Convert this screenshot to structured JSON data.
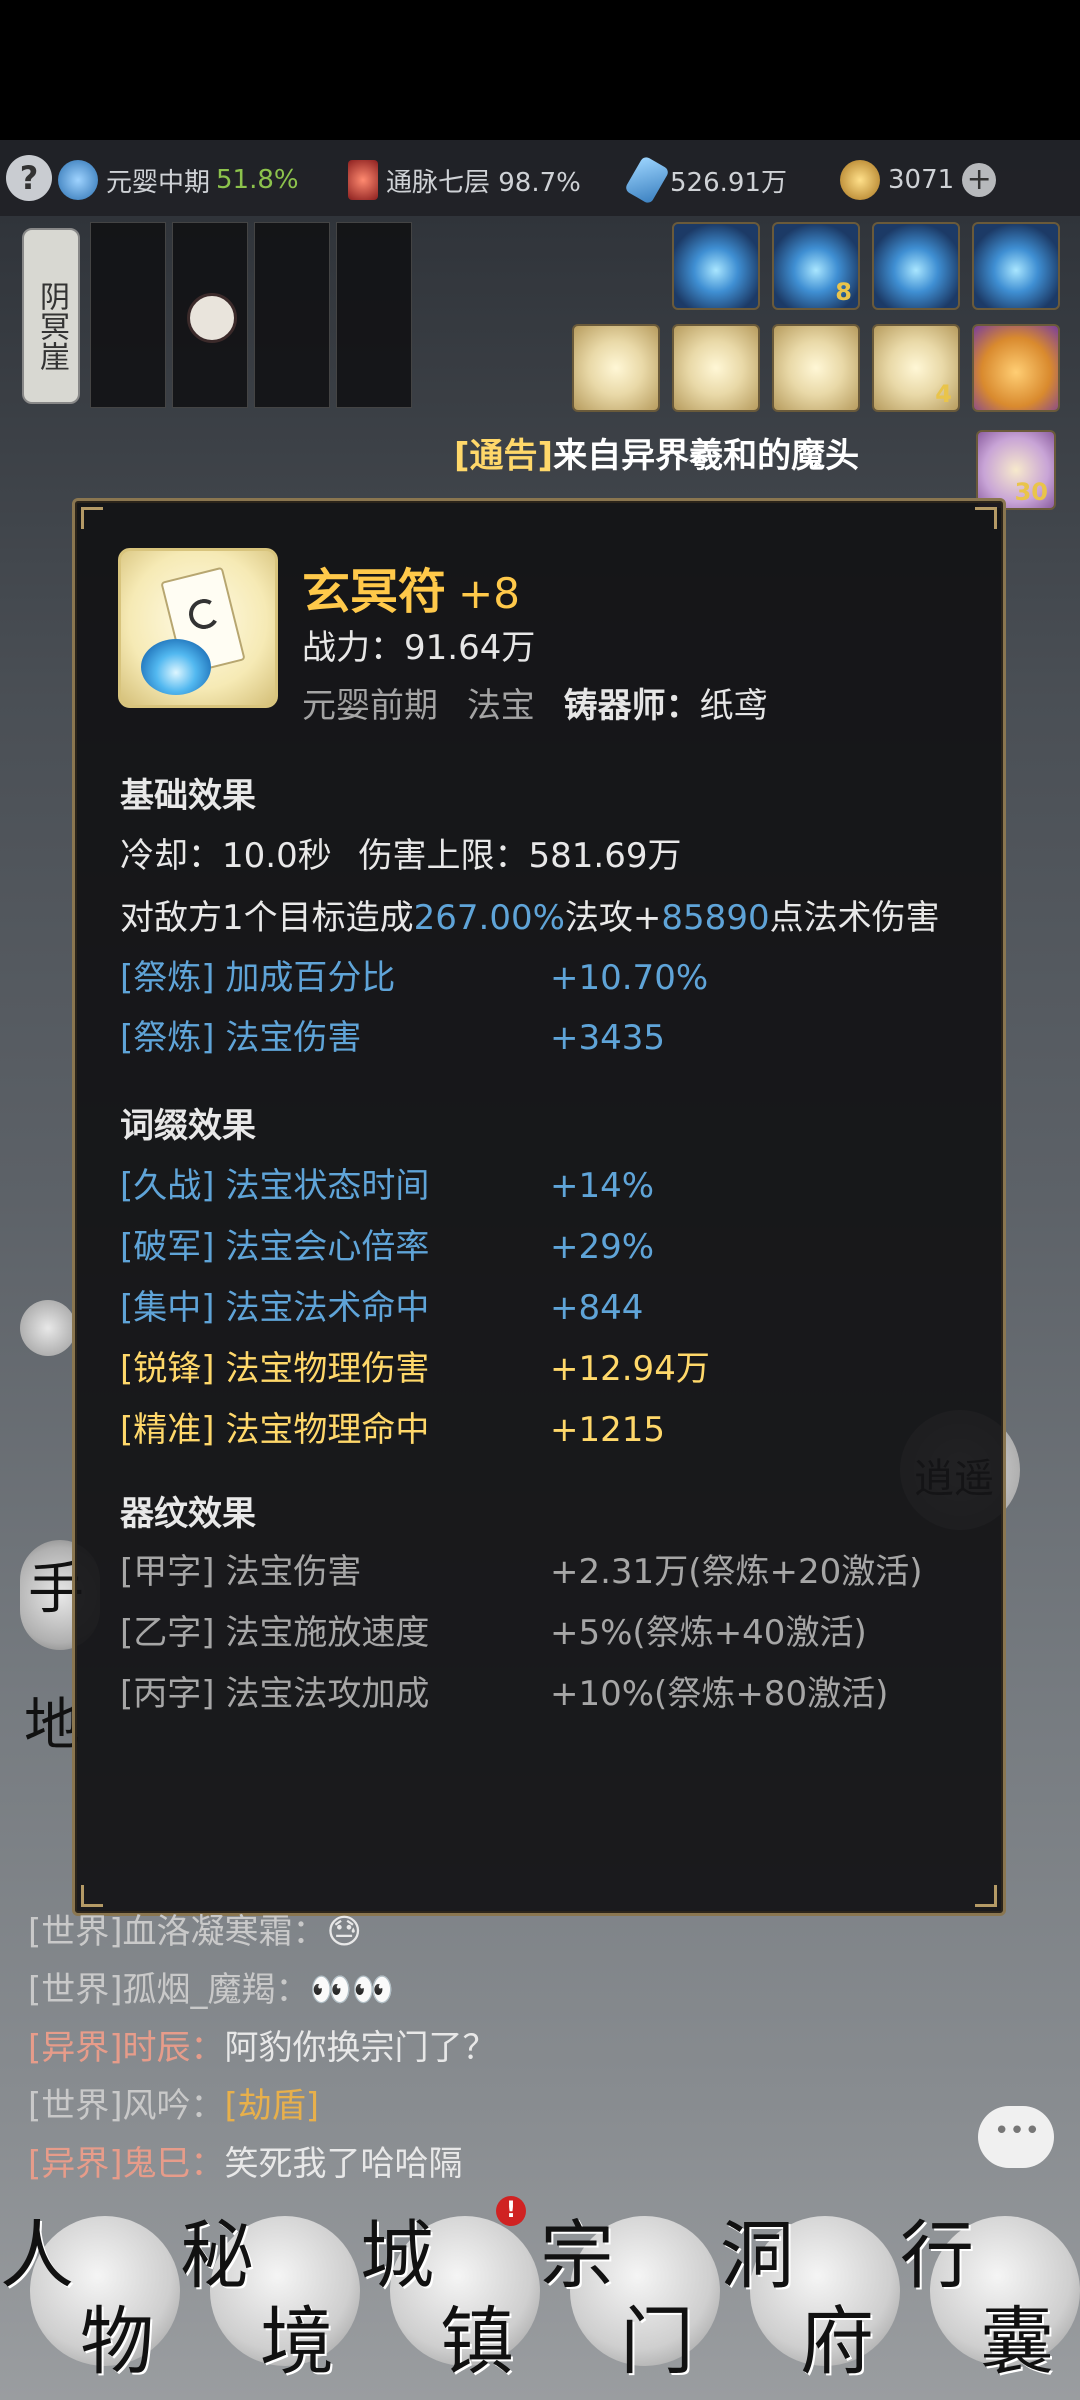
{
  "status": {
    "help_icon": "question-icon",
    "realm": "元婴中期",
    "realm_pct": "51.8%",
    "meridian": "通脉七层 98.7%",
    "spirit_stones": "526.91万",
    "coins": "3071",
    "plus": "+"
  },
  "location": "阴冥崖",
  "skills_top": [
    {
      "type": "blue",
      "count": ""
    },
    {
      "type": "blue",
      "count": "8"
    },
    {
      "type": "blue",
      "count": ""
    },
    {
      "type": "blue",
      "count": ""
    }
  ],
  "skills_row2": [
    {
      "type": "scroll",
      "count": ""
    },
    {
      "type": "scroll",
      "count": ""
    },
    {
      "type": "scroll",
      "count": ""
    },
    {
      "type": "scroll",
      "count": "4"
    },
    {
      "type": "gourd",
      "count": ""
    }
  ],
  "side_count": "30",
  "notice": {
    "tag": "[通告]",
    "text": "来自异界羲和的魔头"
  },
  "item": {
    "name": "玄冥符",
    "level": "+8",
    "power_label": "战力：",
    "power_value": "91.64万",
    "realm": "元婴前期",
    "category": "法宝",
    "maker_label": "铸器师：",
    "maker": "纸鸢"
  },
  "basic": {
    "title": "基础效果",
    "cooldown": "冷却：10.0秒",
    "damage_cap": "伤害上限：581.69万",
    "desc_pre": "对敌方1个目标造成",
    "desc_pct": "267.00%",
    "desc_mid": "法攻+",
    "desc_num": "85890",
    "desc_post": "点法术伤害",
    "rows": [
      {
        "label": "[祭炼] 加成百分比",
        "value": "+10.70%"
      },
      {
        "label": "[祭炼] 法宝伤害",
        "value": "+3435"
      }
    ]
  },
  "affix": {
    "title": "词缀效果",
    "rows": [
      {
        "label": "[久战] 法宝状态时间",
        "value": "+14%",
        "color": "#5fa4d8"
      },
      {
        "label": "[破军] 法宝会心倍率",
        "value": "+29%",
        "color": "#5fa4d8"
      },
      {
        "label": "[集中] 法宝法术命中",
        "value": "+844",
        "color": "#5fa4d8"
      },
      {
        "label": "[锐锋] 法宝物理伤害",
        "value": "+12.94万",
        "color": "#ffd86a"
      },
      {
        "label": "[精准] 法宝物理命中",
        "value": "+1215",
        "color": "#ffd86a"
      }
    ]
  },
  "pattern": {
    "title": "器纹效果",
    "rows": [
      {
        "label": "[甲字] 法宝伤害",
        "value": "+2.31万(祭炼+20激活)"
      },
      {
        "label": "[乙字] 法宝施放速度",
        "value": "+5%(祭炼+40激活)"
      },
      {
        "label": "[丙字] 法宝法攻加成",
        "value": "+10%(祭炼+80激活)"
      }
    ]
  },
  "chat": [
    {
      "ch": "[世界]",
      "name": "血洛凝寒霜：",
      "msg": "😓",
      "cc": "#c9c9c9",
      "mc": "#e8e8e8"
    },
    {
      "ch": "[世界]",
      "name": "孤烟_魔羯：",
      "msg": "👀👀",
      "cc": "#c9c9c9",
      "mc": "#e8e8e8"
    },
    {
      "ch": "[异界]",
      "name": "时辰：",
      "msg": "阿豹你换宗门了？",
      "cc": "#e79c8a",
      "mc": "#e8e8e8"
    },
    {
      "ch": "[世界]",
      "name": "风吟：",
      "msg": "[劫盾]",
      "cc": "#c9c9c9",
      "mc": "#e8b04b"
    },
    {
      "ch": "[异界]",
      "name": "鬼巳：",
      "msg": "笑死我了哈哈隔",
      "cc": "#e79c8a",
      "mc": "#e8e8e8"
    }
  ],
  "nav": [
    {
      "c1": "人",
      "c2": "物"
    },
    {
      "c1": "秘",
      "c2": "境"
    },
    {
      "c1": "城",
      "c2": "镇"
    },
    {
      "c1": "宗",
      "c2": "门"
    },
    {
      "c1": "洞",
      "c2": "府"
    },
    {
      "c1": "行",
      "c2": "囊"
    }
  ],
  "nav_badge": "!",
  "side_labels": {
    "l1": "手",
    "l2": "地",
    "r1": "逍遥"
  }
}
